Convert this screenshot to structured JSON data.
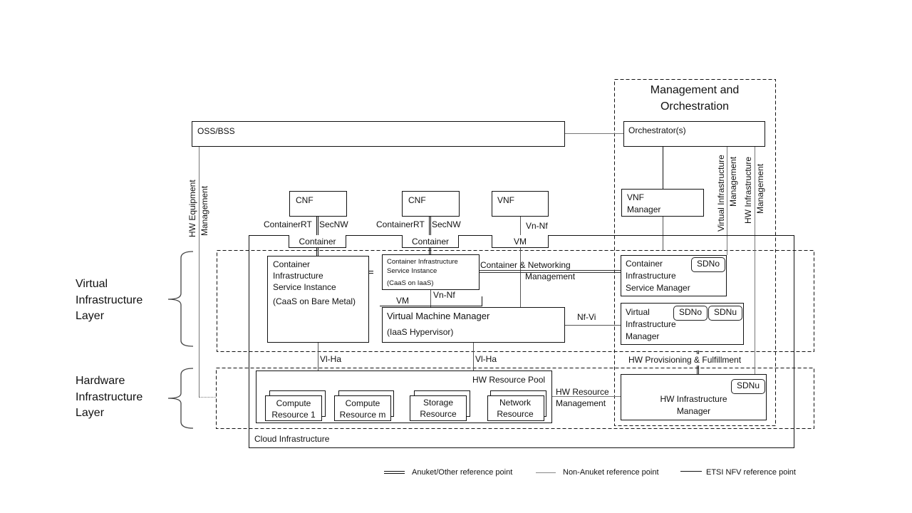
{
  "mano": {
    "title_line1": "Management and",
    "title_line2": "Orchestration",
    "orchestrator": "Orchestrator(s)",
    "vnf_manager_line1": "VNF",
    "vnf_manager_line2": "Manager",
    "vi_mgmt_line1": "Virtual Infrastructure",
    "vi_mgmt_line2": "Management",
    "hw_mgmt_line1": "HW Infrastructure",
    "hw_mgmt_line2": "Management"
  },
  "oss_bss": "OSS/BSS",
  "hw_equipment_mgmt_line1": "HW Equipment",
  "hw_equipment_mgmt_line2": "Management",
  "layers": {
    "virtual": [
      "Virtual",
      "Infrastructure",
      "Layer"
    ],
    "hardware": [
      "Hardware",
      "Infrastructure",
      "Layer"
    ]
  },
  "workloads": {
    "cnf1": "CNF",
    "cnf2": "CNF",
    "vnf": "VNF",
    "container1": "Container",
    "container2": "Container",
    "vm": "VM",
    "containerrt1": "ContainerRT",
    "secnw1": "SecNW",
    "containerrt2": "ContainerRT",
    "secnw2": "SecNW",
    "vn_nf_top": "Vn-Nf"
  },
  "cis_bare_metal": {
    "line1": "Container",
    "line2": "Infrastructure",
    "line3": "Service Instance",
    "line4": "(CaaS on Bare Metal)"
  },
  "cis_iaas": {
    "line1": "Container Infrastructure",
    "line2": "Service Instance",
    "line3": "(CaaS on IaaS)"
  },
  "inner_vm": "VM",
  "vn_nf_inner": "Vn-Nf",
  "vmm": {
    "line1": "Virtual Machine Manager",
    "line2": "(IaaS Hypervisor)"
  },
  "container_net_mgmt_line1": "Container & Networking",
  "container_net_mgmt_line2": "Management",
  "nf_vi": "Nf-Vi",
  "cism": {
    "line1": "Container",
    "line2": "Infrastructure",
    "line3": "Service Manager",
    "badge": "SDNo"
  },
  "vim": {
    "line1": "Virtual",
    "line2": "Infrastructure",
    "line3": "Manager",
    "badge1": "SDNo",
    "badge2": "SDNu"
  },
  "hw_provisioning": "HW Provisioning & Fulfillment",
  "vi_ha_1": "Vl-Ha",
  "vi_ha_2": "Vl-Ha",
  "hw_resource_pool": {
    "title": "HW Resource Pool",
    "resources": [
      {
        "line1": "Compute",
        "line2": "Resource 1"
      },
      {
        "line1": "Compute",
        "line2": "Resource m"
      },
      {
        "line1": "Storage",
        "line2": "Resource"
      },
      {
        "line1": "Network",
        "line2": "Resource"
      }
    ]
  },
  "hw_resource_mgmt_line1": "HW Resource",
  "hw_resource_mgmt_line2": "Management",
  "him": {
    "line1": "HW Infrastructure",
    "line2": "Manager",
    "badge": "SDNu"
  },
  "cloud_infrastructure": "Cloud  Infrastructure",
  "legend": [
    {
      "style": "double",
      "label": "Anuket/Other  reference point"
    },
    {
      "style": "thin",
      "label": "Non-Anuket  reference point"
    },
    {
      "style": "solid",
      "label": "ETSI NFV reference point"
    }
  ]
}
